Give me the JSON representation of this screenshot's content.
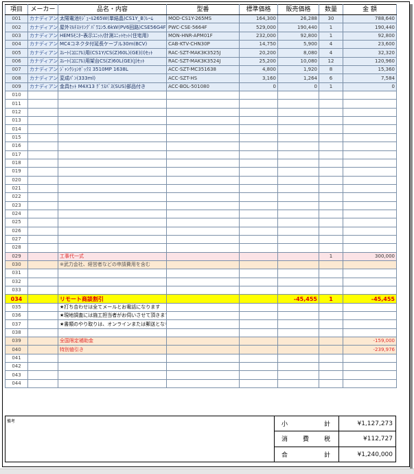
{
  "headers": [
    "項目",
    "メーカー",
    "品名・内容",
    "型番",
    "標準価格",
    "販売価格",
    "数量",
    "金 額"
  ],
  "rows": [
    {
      "no": "001",
      "maker": "カナディアン",
      "name": "太陽電池ﾓｼﾞｭｰﾙ265W(単結晶)CS1Y_Bﾌﾚｰﾑ",
      "model": "MOD-CS1Y-265MS",
      "std": "164,300",
      "price": "26,288",
      "qty": "30",
      "amount": "788,640",
      "style": "product"
    },
    {
      "no": "002",
      "maker": "カナディアン",
      "name": "屋外ﾏﾙﾁｽﾄﾘﾝｸﾞﾊﾟﾜｺﾝ5.6kW(PV6回路)CSE56G4F",
      "model": "PWC-CSE-5664F",
      "std": "529,000",
      "price": "190,440",
      "qty": "1",
      "amount": "190,440",
      "style": "product"
    },
    {
      "no": "003",
      "maker": "カナディアン",
      "name": "HEMSﾓﾆﾀｰ表示ﾕﾆｯﾄ/計測ﾕﾆｯﾄｾｯﾄ(住宅用)",
      "model": "MON-HNR-APM01F",
      "std": "232,000",
      "price": "92,800",
      "qty": "1",
      "amount": "92,800",
      "style": "product"
    },
    {
      "no": "004",
      "maker": "カナディアン",
      "name": "MC4コネクタ付延長ケーブル30m(BCV)",
      "model": "CAB-KTV-CHN30P",
      "std": "14,750",
      "price": "5,900",
      "qty": "4",
      "amount": "23,600",
      "style": "product"
    },
    {
      "no": "005",
      "maker": "カナディアン",
      "name": "ｽﾚｰﾄ(ｺﾛﾆｱﾙ)用(CS1Y/CS(Z)60L)(GE)(I)ｾｯﾄ",
      "model": "RAC-SZT-MAK3K3525J",
      "std": "20,200",
      "price": "8,080",
      "qty": "4",
      "amount": "32,320",
      "style": "product"
    },
    {
      "no": "006",
      "maker": "カナディアン",
      "name": "ｽﾚｰﾄ(ｺﾛﾆｱﾙ)用架台CS(Z)60L(GE)(J)ｾｯﾄ",
      "model": "RAC-SZT-MAK3K3524J",
      "std": "25,200",
      "price": "10,080",
      "qty": "12",
      "amount": "120,960",
      "style": "product"
    },
    {
      "no": "007",
      "maker": "カナディアン",
      "name": "ｼﾞｬﾝｸｼｮﾝﾎﾞｯｸｽ 3510MP 1638L",
      "model": "ACC-SZT-MC351638",
      "std": "4,800",
      "price": "1,920",
      "qty": "8",
      "amount": "15,360",
      "style": "product"
    },
    {
      "no": "008",
      "maker": "カナディアン",
      "name": "変成ﾊﾟﾝ(333ml)",
      "model": "ACC-SZT-HS",
      "std": "3,160",
      "price": "1,264",
      "qty": "6",
      "amount": "7,584",
      "style": "product"
    },
    {
      "no": "009",
      "maker": "カナディアン",
      "name": "金具ｾｯﾄ M4X13 ｸﾞﾗｽﾊﾞｽ(SUS)部品付き",
      "model": "ACC-BOL-501080",
      "std": "0",
      "price": "0",
      "qty": "1",
      "amount": "0",
      "style": "product"
    },
    {
      "no": "010",
      "style": "blank"
    },
    {
      "no": "011",
      "style": "blank"
    },
    {
      "no": "012",
      "style": "blank"
    },
    {
      "no": "013",
      "style": "blank"
    },
    {
      "no": "014",
      "style": "blank"
    },
    {
      "no": "015",
      "style": "blank"
    },
    {
      "no": "016",
      "style": "blank"
    },
    {
      "no": "017",
      "style": "blank"
    },
    {
      "no": "018",
      "style": "blank"
    },
    {
      "no": "019",
      "style": "blank"
    },
    {
      "no": "020",
      "style": "blank"
    },
    {
      "no": "021",
      "style": "blank"
    },
    {
      "no": "022",
      "style": "blank"
    },
    {
      "no": "023",
      "style": "blank"
    },
    {
      "no": "024",
      "style": "blank"
    },
    {
      "no": "025",
      "style": "blank"
    },
    {
      "no": "026",
      "style": "blank"
    },
    {
      "no": "027",
      "style": "blank"
    },
    {
      "no": "028",
      "style": "blank"
    },
    {
      "no": "029",
      "name": "工事代一式",
      "qty": "1",
      "amount": "300,000",
      "style": "pink"
    },
    {
      "no": "030",
      "name": "※武力会社、経営者などの申請費用を含む",
      "style": "peach"
    },
    {
      "no": "031",
      "style": "blank"
    },
    {
      "no": "032",
      "style": "blank"
    },
    {
      "no": "033",
      "style": "blank"
    },
    {
      "no": "034",
      "name": "リモート商談割引",
      "price": "-45,455",
      "qty": "1",
      "amount": "-45,455",
      "style": "yellow"
    },
    {
      "no": "035",
      "name": "★打ち合わせは全てメールとお電話になります",
      "style": "note"
    },
    {
      "no": "036",
      "name": "★現地調査には施工担当者がお伺いさせて頂きます",
      "style": "note"
    },
    {
      "no": "037",
      "name": "★書類のやり取りは、オンラインまたは郵送となります",
      "style": "note"
    },
    {
      "no": "038",
      "style": "blank"
    },
    {
      "no": "039",
      "name": "全国限定補助金",
      "amount": "-159,000",
      "style": "peach-red"
    },
    {
      "no": "040",
      "name": "特別値引き",
      "amount": "-239,976",
      "style": "peach-red"
    },
    {
      "no": "041",
      "style": "blank"
    },
    {
      "no": "042",
      "style": "blank"
    },
    {
      "no": "043",
      "style": "blank"
    },
    {
      "no": "044",
      "style": "blank"
    }
  ],
  "remarks_label": "備考",
  "totals": {
    "subtotal_label": [
      "小",
      "計"
    ],
    "subtotal_value": "¥1,127,273",
    "tax_label": [
      "消",
      "費",
      "税"
    ],
    "tax_value": "¥112,727",
    "total_label": [
      "合",
      "計"
    ],
    "total_value": "¥1,240,000"
  }
}
